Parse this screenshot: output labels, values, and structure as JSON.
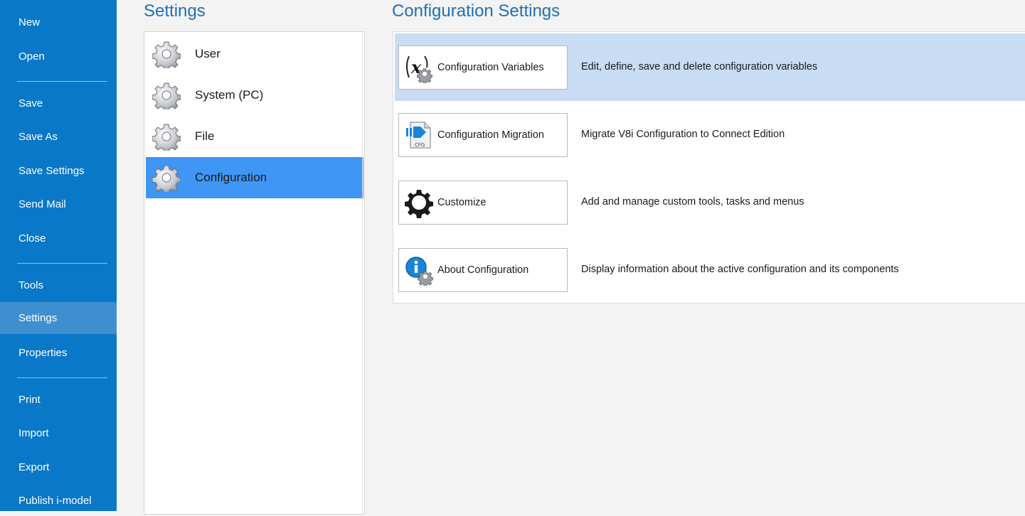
{
  "nav": {
    "items": [
      {
        "label": "New"
      },
      {
        "label": "Open"
      },
      {
        "label": "Save"
      },
      {
        "label": "Save As"
      },
      {
        "label": "Save Settings"
      },
      {
        "label": "Send Mail"
      },
      {
        "label": "Close"
      },
      {
        "label": "Tools"
      },
      {
        "label": "Settings",
        "active": true
      },
      {
        "label": "Properties"
      },
      {
        "label": "Print"
      },
      {
        "label": "Import"
      },
      {
        "label": "Export"
      },
      {
        "label": "Publish i-model"
      }
    ]
  },
  "settings": {
    "heading": "Settings",
    "items": [
      {
        "label": "User",
        "icon": "gear-icon"
      },
      {
        "label": "System (PC)",
        "icon": "gear-icon"
      },
      {
        "label": "File",
        "icon": "gear-icon"
      },
      {
        "label": "Configuration",
        "icon": "gear-icon",
        "active": true
      }
    ]
  },
  "configuration": {
    "heading": "Configuration Settings",
    "rows": [
      {
        "button": "Configuration Variables",
        "description": "Edit, define, save and delete configuration variables",
        "icon": "variable-gear-icon",
        "highlighted": true
      },
      {
        "button": "Configuration Migration",
        "description": "Migrate V8i Configuration to Connect Edition",
        "icon": "cfg-migration-icon",
        "icon_text": "CFG"
      },
      {
        "button": "Customize",
        "description": "Add and manage custom tools, tasks and menus",
        "icon": "black-gear-icon"
      },
      {
        "button": "About Configuration",
        "description": "Display information about the active configuration and its components",
        "icon": "info-gear-icon"
      }
    ]
  },
  "colors": {
    "nav_background": "#0a78c8",
    "nav_active": "#3f8fd0",
    "heading": "#1e70b8",
    "list_selected": "#3f96f4",
    "row_highlight": "#c8dcf3"
  }
}
